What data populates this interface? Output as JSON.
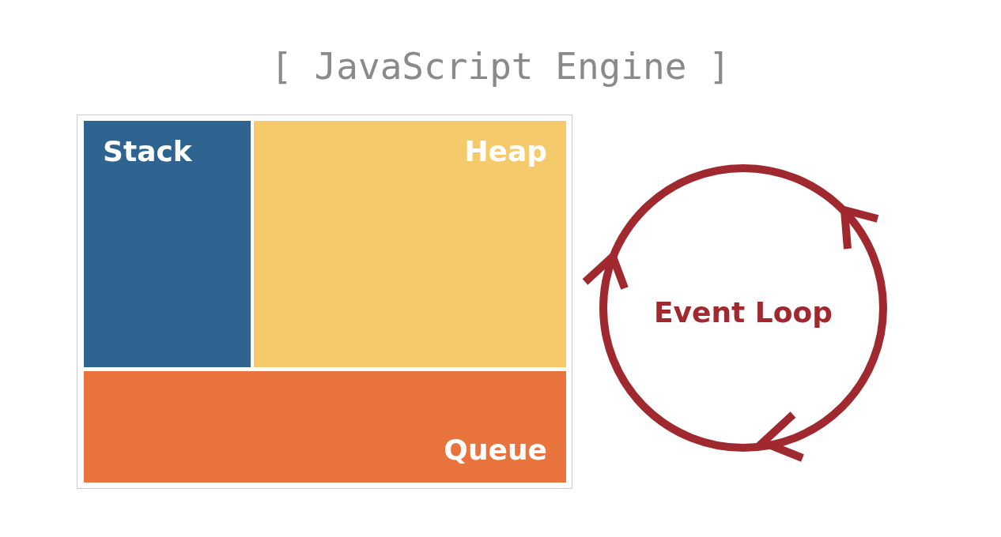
{
  "title": "[ JavaScript Engine ]",
  "blocks": [
    {
      "kind": "stack",
      "label": "Stack",
      "color": "#2f6491"
    },
    {
      "kind": "heap",
      "label": "Heap",
      "color": "#f4ca6a"
    },
    {
      "kind": "queue",
      "label": "Queue",
      "color": "#e8733d"
    }
  ],
  "loop": {
    "label": "Event Loop"
  }
}
